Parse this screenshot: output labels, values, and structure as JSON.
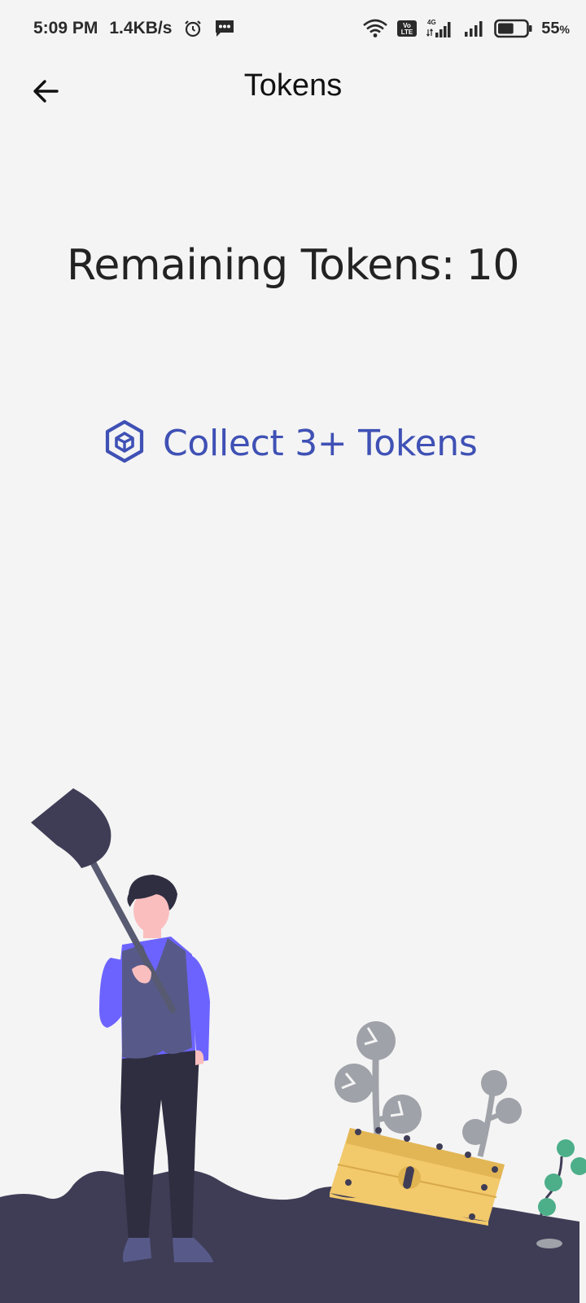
{
  "status_bar": {
    "time": "5:09 PM",
    "speed": "1.4KB/s",
    "icons_left": [
      "alarm-icon",
      "message-icon"
    ],
    "icons_right": [
      "wifi-icon",
      "volte-icon",
      "signal-4g-icon",
      "signal-icon",
      "battery-icon"
    ],
    "battery_value": "55",
    "battery_unit": "%",
    "battery_level": 0.55
  },
  "app_bar": {
    "title": "Tokens",
    "back_icon": "arrow-back-icon"
  },
  "main": {
    "remaining_label": "Remaining Tokens:",
    "remaining_count": "10",
    "collect_label": "Collect 3+ Tokens",
    "collect_icon": "cube-token-icon"
  },
  "colors": {
    "background": "#f4f4f4",
    "accent": "#3f51b5",
    "ground": "#3f3d56",
    "chest": "#f2c96b",
    "shirt": "#6c63ff"
  }
}
